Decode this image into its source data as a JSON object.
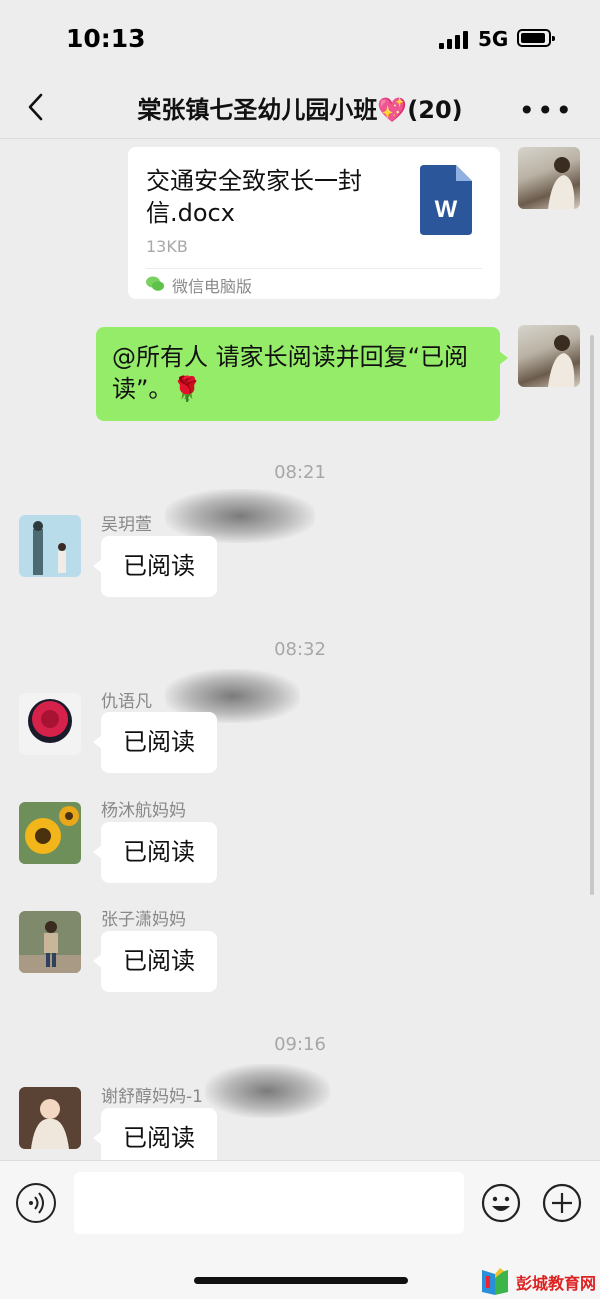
{
  "status_bar": {
    "time": "10:13",
    "network": "5G"
  },
  "header": {
    "title": "棠张镇七圣幼儿园小班💖(20)",
    "more": "•••"
  },
  "messages": {
    "file": {
      "name": "交通安全致家长一封信.docx",
      "size": "13KB",
      "source": "微信电脑版",
      "doc_letter": "W"
    },
    "mention": {
      "text": "@所有人 请家长阅读并回复“已阅读”。🌹"
    },
    "time1": "08:21",
    "reply1": {
      "sender": "吴玥萱",
      "text": "已阅读"
    },
    "time2": "08:32",
    "reply2": {
      "sender": "仇语凡",
      "text": "已阅读"
    },
    "reply3": {
      "sender": "杨沐航妈妈",
      "text": "已阅读"
    },
    "reply4": {
      "sender": "张子潇妈妈",
      "text": "已阅读"
    },
    "time3": "09:16",
    "reply5": {
      "sender": "谢舒醇妈妈-1",
      "text": "已阅读"
    }
  },
  "watermark": {
    "text": "彭城教育网"
  },
  "colors": {
    "bubble_green": "#95ec69",
    "background": "#ededed",
    "doc_blue": "#2b579a"
  },
  "icons": [
    "back-icon",
    "more-icon",
    "word-doc-icon",
    "wechat-icon",
    "voice-icon",
    "emoji-icon",
    "plus-icon"
  ]
}
